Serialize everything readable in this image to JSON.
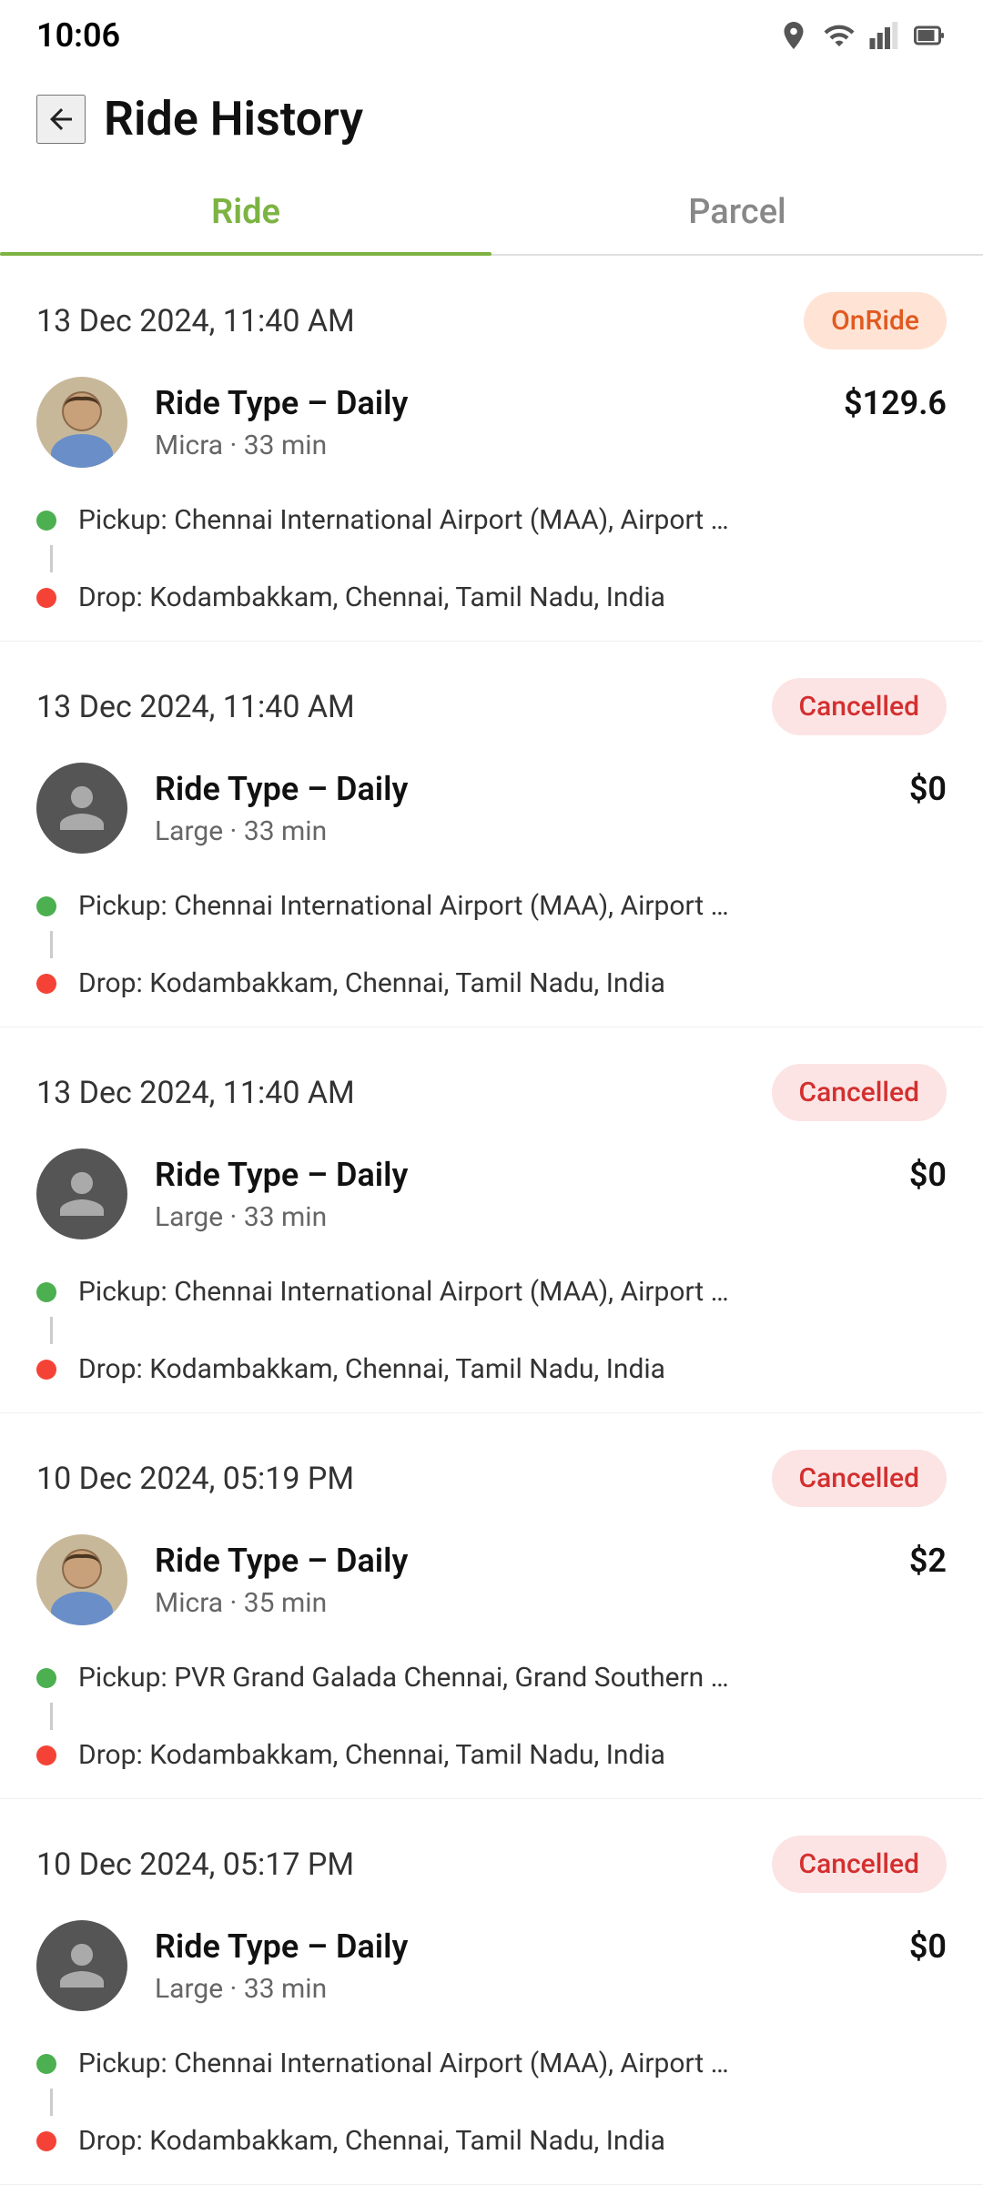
{
  "statusBar": {
    "time": "10:06"
  },
  "header": {
    "title": "Ride History",
    "backLabel": "back"
  },
  "tabs": [
    {
      "id": "ride",
      "label": "Ride",
      "active": true
    },
    {
      "id": "parcel",
      "label": "Parcel",
      "active": false
    }
  ],
  "rides": [
    {
      "id": "ride-1",
      "date": "13 Dec 2024, 11:40 AM",
      "status": "OnRide",
      "statusType": "onride",
      "rideType": "Ride Type – Daily",
      "price": "$129.6",
      "vehicle": "Micra · 33 min",
      "pickup": "Pickup: Chennai International Airport (MAA), Airport …",
      "drop": "Drop: Kodambakkam, Chennai, Tamil Nadu, India",
      "hasPhoto": true
    },
    {
      "id": "ride-2",
      "date": "13 Dec 2024, 11:40 AM",
      "status": "Cancelled",
      "statusType": "cancelled",
      "rideType": "Ride Type – Daily",
      "price": "$0",
      "vehicle": "Large · 33 min",
      "pickup": "Pickup: Chennai International Airport (MAA), Airport …",
      "drop": "Drop: Kodambakkam, Chennai, Tamil Nadu, India",
      "hasPhoto": false
    },
    {
      "id": "ride-3",
      "date": "13 Dec 2024, 11:40 AM",
      "status": "Cancelled",
      "statusType": "cancelled",
      "rideType": "Ride Type – Daily",
      "price": "$0",
      "vehicle": "Large · 33 min",
      "pickup": "Pickup: Chennai International Airport (MAA), Airport …",
      "drop": "Drop: Kodambakkam, Chennai, Tamil Nadu, India",
      "hasPhoto": false
    },
    {
      "id": "ride-4",
      "date": "10 Dec 2024, 05:19 PM",
      "status": "Cancelled",
      "statusType": "cancelled",
      "rideType": "Ride Type – Daily",
      "price": "$2",
      "vehicle": "Micra · 35 min",
      "pickup": "Pickup: PVR Grand Galada Chennai, Grand Southern …",
      "drop": "Drop: Kodambakkam, Chennai, Tamil Nadu, India",
      "hasPhoto": true
    },
    {
      "id": "ride-5",
      "date": "10 Dec 2024, 05:17 PM",
      "status": "Cancelled",
      "statusType": "cancelled",
      "rideType": "Ride Type – Daily",
      "price": "$0",
      "vehicle": "Large · 33 min",
      "pickup": "Pickup: Chennai International Airport (MAA), Airport …",
      "drop": "Drop: Kodambakkam, Chennai, Tamil Nadu, India",
      "hasPhoto": false
    }
  ]
}
